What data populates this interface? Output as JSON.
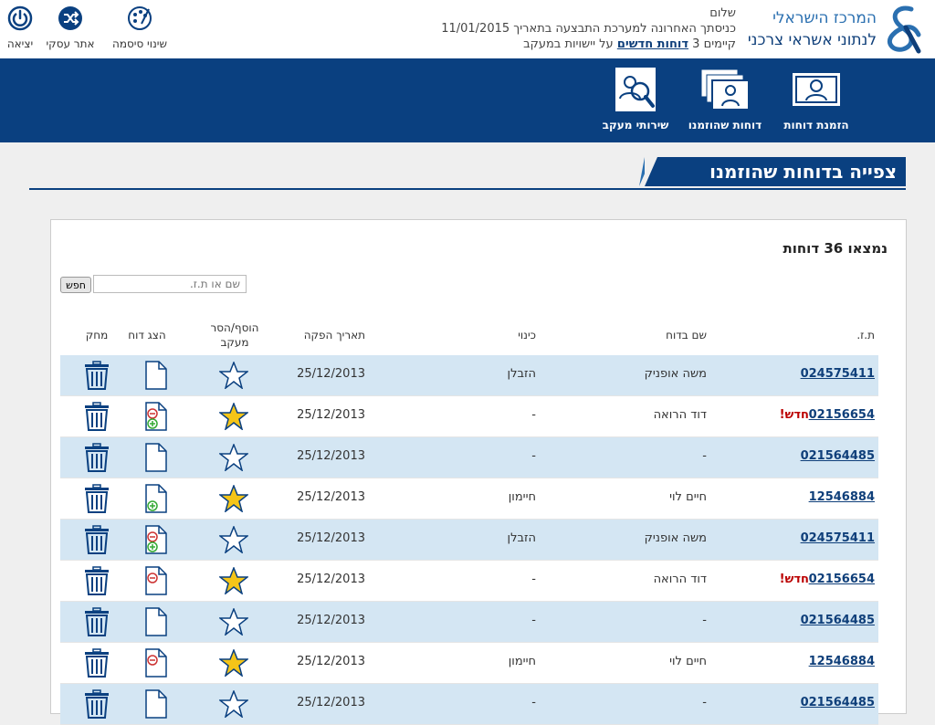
{
  "header": {
    "logo_line1": "המרכז הישראלי",
    "logo_line2": "לנתוני אשראי צרכני",
    "greeting": "שלום",
    "last_login": "כניסתך האחרונה למערכת התבצעה בתאריך 11/01/2015",
    "reports_prefix": "קיימים 3",
    "reports_link": "דוחות חדשים",
    "reports_suffix": "על יישויות במעקב",
    "utils": [
      {
        "label": "יציאה",
        "icon": "power-icon"
      },
      {
        "label": "אתר עסקי",
        "icon": "shuffle-icon"
      },
      {
        "label": "שינוי סיסמה",
        "icon": "palette-icon"
      }
    ]
  },
  "nav": {
    "items": [
      {
        "label": "הזמנת דוחות",
        "icon": "user-card-icon"
      },
      {
        "label": "דוחות שהוזמנו",
        "icon": "stacked-cards-icon"
      },
      {
        "label": "שירותי מעקב",
        "icon": "magnifier-user-icon"
      }
    ]
  },
  "page": {
    "title": "צפייה בדוחות שהוזמנו",
    "count": "נמצאו 36 דוחות",
    "search_placeholder": "שם או ת.ז.",
    "search_button": "חפש"
  },
  "table": {
    "columns": [
      "ת.ז.",
      "שם בדוח",
      "כינוי",
      "תאריך הפקה",
      "הוסף/הסר",
      "מעקב",
      "הצג דוח",
      "מחק"
    ],
    "rows": [
      {
        "id": "024575411",
        "new": "",
        "name": "משה אופניק",
        "nick": "הזבלן",
        "date": "25/12/2013",
        "starred": false,
        "doc": "plain"
      },
      {
        "id": "02156654",
        "new": "חדש!",
        "name": "דוד הרואה",
        "nick": "-",
        "date": "25/12/2013",
        "starred": true,
        "doc": "minus-plus"
      },
      {
        "id": "021564485",
        "new": "",
        "name": "-",
        "nick": "-",
        "date": "25/12/2013",
        "starred": false,
        "doc": "plain"
      },
      {
        "id": "12546884",
        "new": "",
        "name": "חיים לוי",
        "nick": "חיימון",
        "date": "25/12/2013",
        "starred": true,
        "doc": "plus"
      },
      {
        "id": "024575411",
        "new": "",
        "name": "משה אופניק",
        "nick": "הזבלן",
        "date": "25/12/2013",
        "starred": false,
        "doc": "minus-plus"
      },
      {
        "id": "02156654",
        "new": "חדש!",
        "name": "דוד הרואה",
        "nick": "-",
        "date": "25/12/2013",
        "starred": true,
        "doc": "minus"
      },
      {
        "id": "021564485",
        "new": "",
        "name": "-",
        "nick": "-",
        "date": "25/12/2013",
        "starred": false,
        "doc": "plain"
      },
      {
        "id": "12546884",
        "new": "",
        "name": "חיים לוי",
        "nick": "חיימון",
        "date": "25/12/2013",
        "starred": true,
        "doc": "minus"
      },
      {
        "id": "021564485",
        "new": "",
        "name": "-",
        "nick": "-",
        "date": "25/12/2013",
        "starred": false,
        "doc": "plain"
      }
    ]
  },
  "colors": {
    "brand_blue": "#0a4080",
    "row_blue": "#d4e6f3",
    "star_gold": "#f5c518",
    "new_red": "#b00000"
  }
}
